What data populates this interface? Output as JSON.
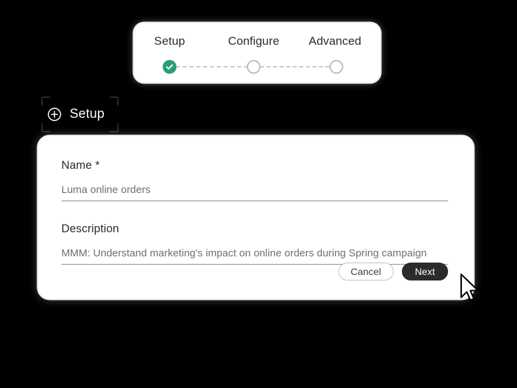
{
  "stepper": {
    "steps": [
      {
        "label": "Setup",
        "state": "complete",
        "icon": "check-icon"
      },
      {
        "label": "Configure",
        "state": "upcoming",
        "icon": "circle-outline-icon"
      },
      {
        "label": "Advanced",
        "state": "upcoming",
        "icon": "circle-outline-icon"
      }
    ],
    "accent_complete": "#2d9d78",
    "track_color": "#c9c9c9"
  },
  "section": {
    "title": "Setup",
    "icon": "plus-circle-icon"
  },
  "form": {
    "name": {
      "label": "Name *",
      "value": "Luma online orders"
    },
    "description": {
      "label": "Description",
      "value": "MMM: Understand marketing's impact on online orders during Spring campaign"
    },
    "buttons": {
      "cancel": "Cancel",
      "next": "Next"
    }
  },
  "colors": {
    "background": "#000000",
    "card": "#ffffff",
    "text_primary": "#2b2b2b",
    "text_value": "#6e6e6e",
    "primary_button": "#2b2b2b"
  }
}
